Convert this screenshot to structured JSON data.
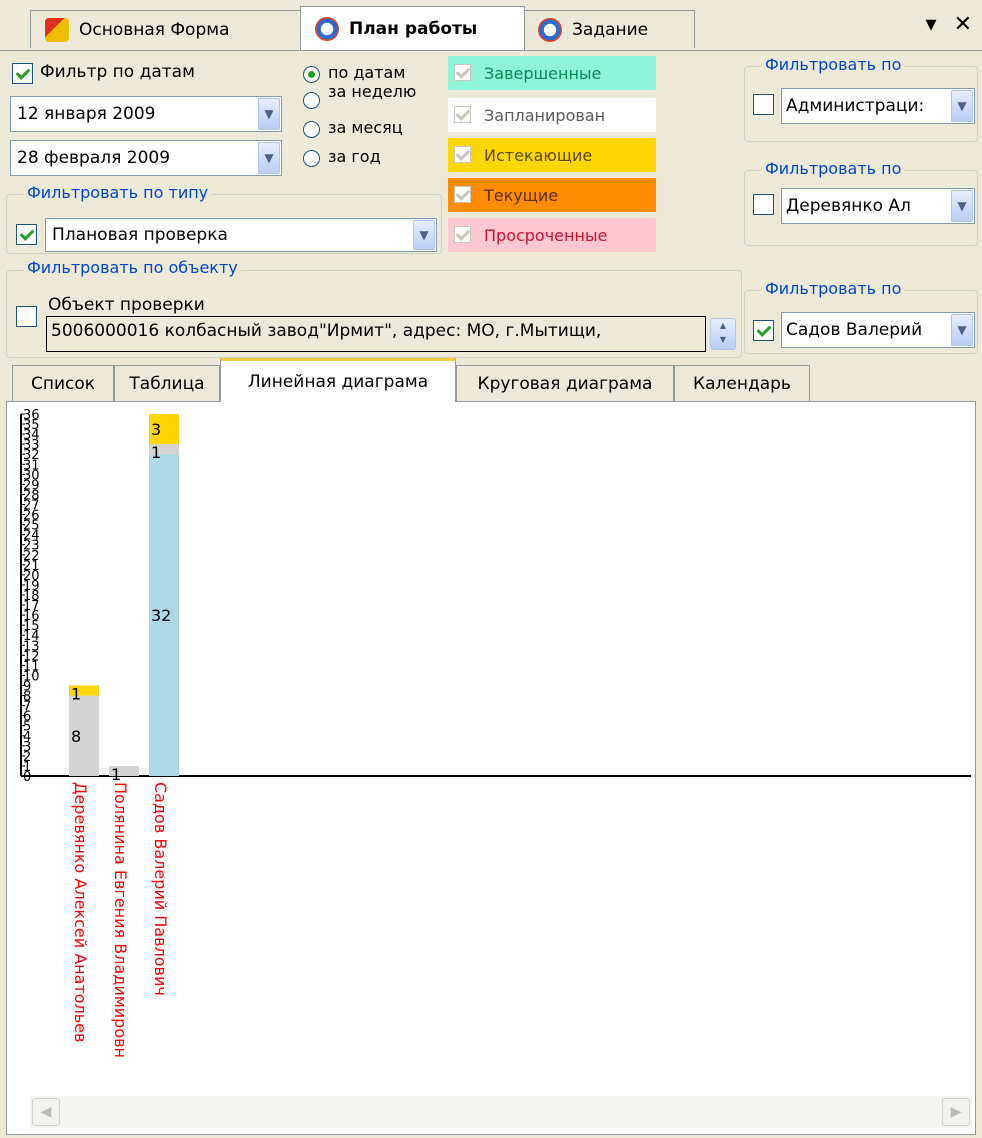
{
  "doc_tabs": [
    {
      "label": "Основная Форма",
      "icon": "form-app-icon"
    },
    {
      "label": "План работы",
      "icon": "alarm-clock-icon",
      "active": true
    },
    {
      "label": "Задание",
      "icon": "alarm-clock-icon"
    }
  ],
  "window_controls": {
    "menu": "▾",
    "close": "✕"
  },
  "date_filter": {
    "checkbox_label": "Фильтр по датам",
    "checked": true,
    "from_date": "12  января  2009",
    "to_date": "28 февраля 2009"
  },
  "period_radios": [
    {
      "label": "по датам",
      "selected": true
    },
    {
      "label": "за неделю",
      "selected": false
    },
    {
      "label": "за месяц",
      "selected": false
    },
    {
      "label": "за год",
      "selected": false
    }
  ],
  "status_filters": [
    {
      "label": "Завершенные",
      "color": "#8FF5D8",
      "text_color": "#0A8A5A"
    },
    {
      "label": "Запланирован",
      "color": "#FFFFFF",
      "text_color": "#5A5A5A"
    },
    {
      "label": "Истекающие",
      "color": "#FFD700",
      "text_color": "#5A4A00"
    },
    {
      "label": "Текущие",
      "color": "#FF8C00",
      "text_color": "#5A3000"
    },
    {
      "label": "Просроченные",
      "color": "#FFC8D0",
      "text_color": "#D01030"
    }
  ],
  "type_filter": {
    "title": "Фильтровать по типу",
    "checked": true,
    "value": "Плановая проверка"
  },
  "object_filter": {
    "title": "Фильтровать по объекту",
    "checked": false,
    "label": "Объект проверки",
    "value": "5006000016  колбасный завод\"Ирмит\", адрес: МО, г.Мытищи,"
  },
  "right_filters": [
    {
      "title": "Фильтровать по",
      "checked": false,
      "value": "Администраци:"
    },
    {
      "title": "Фильтровать по",
      "checked": false,
      "value": "Деревянко Ал"
    },
    {
      "title": "Фильтровать по",
      "checked": true,
      "value": "Садов Валерий"
    }
  ],
  "view_tabs": [
    "Список",
    "Таблица",
    "Линейная диаграма",
    "Круговая диаграма",
    "Календарь"
  ],
  "active_view_tab": 2,
  "colors": {
    "completed": "#ADD8E6",
    "planned": "#D3D3D3",
    "expiring": "#FFD700",
    "axis_label": "#FF0000"
  },
  "chart_data": {
    "type": "bar",
    "stacked": true,
    "ylim": [
      0,
      36
    ],
    "y_ticks": [
      "0",
      "1",
      "2",
      "3",
      "4",
      "5",
      "6",
      "7",
      "8",
      "9",
      "10",
      "11",
      "12",
      "13",
      "14",
      "15",
      "16",
      "17",
      "18",
      "19",
      "20",
      "21",
      "22",
      "23",
      "24",
      "25",
      "26",
      "27",
      "28",
      "29",
      "30",
      "31",
      "32",
      "33",
      "34",
      "35",
      "36"
    ],
    "categories": [
      "Деревянко Алексей Анатольев",
      "Полянина Евгения Владимировн",
      "Садов Валерий Павлович"
    ],
    "series": [
      {
        "color": "#ADD8E6",
        "values": [
          0,
          0,
          32
        ]
      },
      {
        "color": "#D3D3D3",
        "values": [
          8,
          1,
          1
        ]
      },
      {
        "color": "#FFD700",
        "values": [
          1,
          0,
          3
        ]
      }
    ],
    "data_labels": [
      [
        "",
        "8",
        "1"
      ],
      [
        "",
        "1",
        ""
      ],
      [
        "32",
        "1",
        "3"
      ]
    ]
  }
}
